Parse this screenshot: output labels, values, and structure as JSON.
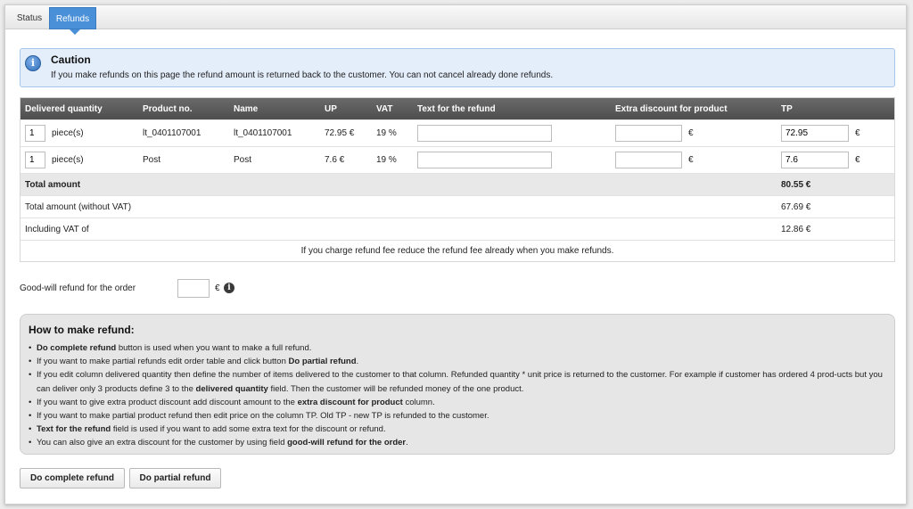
{
  "tabs": [
    {
      "label": "Status",
      "active": false
    },
    {
      "label": "Refunds",
      "active": true
    }
  ],
  "caution": {
    "title": "Caution",
    "text": "If you make refunds on this page the refund amount is returned back to the customer. You can not cancel already done refunds."
  },
  "table": {
    "headers": {
      "qty": "Delivered quantity",
      "product_no": "Product no.",
      "name": "Name",
      "up": "UP",
      "vat": "VAT",
      "text": "Text for the refund",
      "discount": "Extra discount for product",
      "tp": "TP"
    },
    "rows": [
      {
        "qty": "1",
        "unit": "piece(s)",
        "product_no": "lt_0401107001",
        "name": "lt_0401107001",
        "up": "72.95 €",
        "vat": "19 %",
        "text": "",
        "discount": "",
        "discount_currency": "€",
        "tp": "72.95",
        "tp_currency": "€"
      },
      {
        "qty": "1",
        "unit": "piece(s)",
        "product_no": "Post",
        "name": "Post",
        "up": "7.6 €",
        "vat": "19 %",
        "text": "",
        "discount": "",
        "discount_currency": "€",
        "tp": "7.6",
        "tp_currency": "€"
      }
    ],
    "total_label": "Total amount",
    "total_value": "80.55 €",
    "without_vat_label": "Total amount (without VAT)",
    "without_vat_value": "67.69 €",
    "vat_label": "Including VAT of",
    "vat_value": "12.86 €",
    "note": "If you charge refund fee reduce the refund fee already when you make refunds."
  },
  "goodwill": {
    "label": "Good-will refund for the order",
    "value": "",
    "currency": "€"
  },
  "howto": {
    "title": "How to make refund:",
    "items": [
      [
        {
          "b": "Do complete refund"
        },
        {
          "t": " button is used when you want to make a full refund."
        }
      ],
      [
        {
          "t": "If you want to make partial refunds edit order table and click button "
        },
        {
          "b": "Do partial refund"
        },
        {
          "t": "."
        }
      ],
      [
        {
          "t": "If you edit column delivered quantity then define the number of items delivered to the customer to that column. Refunded quantity * unit price is returned to the customer. For example if customer has ordered 4 prod-ucts but you can deliver only 3 products define 3 to the "
        },
        {
          "b": "delivered quantity"
        },
        {
          "t": " field. Then the customer will be refunded money of the one product."
        }
      ],
      [
        {
          "t": "If you want to give extra product discount add discount amount to the "
        },
        {
          "b": "extra discount for product"
        },
        {
          "t": " column."
        }
      ],
      [
        {
          "t": "If you want to make partial product refund then edit price on the column TP. Old TP - new TP is refunded to the customer."
        }
      ],
      [
        {
          "b": "Text for the refund"
        },
        {
          "t": " field is used if you want to add some extra text for the discount or refund."
        }
      ],
      [
        {
          "t": "You can also give an extra discount for the customer by using field "
        },
        {
          "b": "good-will refund for the order"
        },
        {
          "t": "."
        }
      ]
    ]
  },
  "buttons": {
    "complete": "Do complete refund",
    "partial": "Do partial refund"
  }
}
